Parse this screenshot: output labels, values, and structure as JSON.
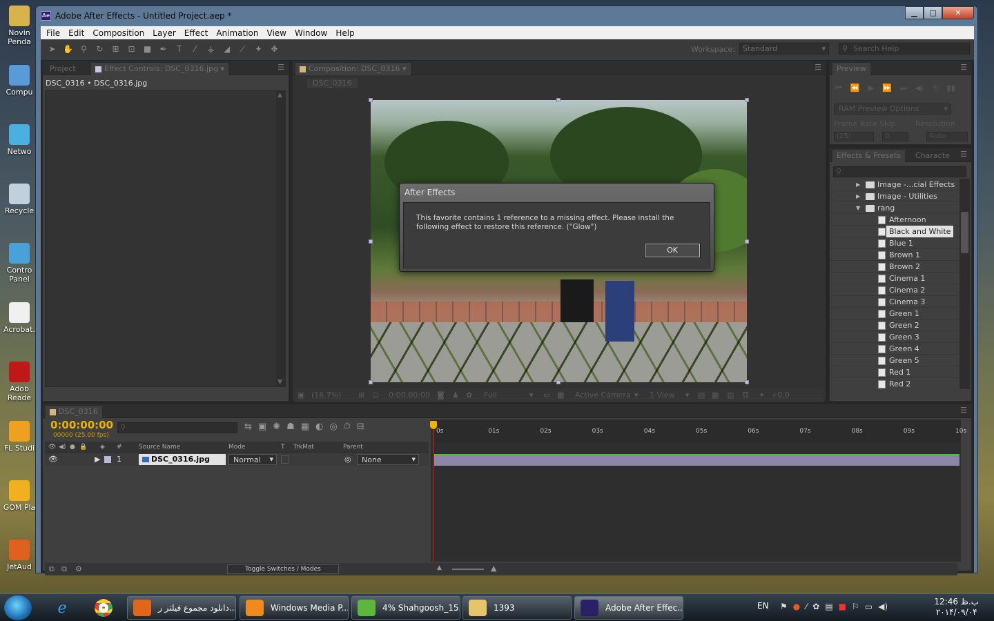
{
  "desktop_icons": [
    {
      "label": "Novin\nPenda",
      "name": "desktop-icon-novin-pendar",
      "color": "#d8b24a"
    },
    {
      "label": "Compu",
      "name": "desktop-icon-computer",
      "color": "#5a9ad8"
    },
    {
      "label": "Netwo",
      "name": "desktop-icon-network",
      "color": "#4ab0e0"
    },
    {
      "label": "Recycle",
      "name": "desktop-icon-recycle-bin",
      "color": "#c0d0dc"
    },
    {
      "label": "Contro\nPanel",
      "name": "desktop-icon-control-panel",
      "color": "#4aa0d8"
    },
    {
      "label": "Acrobat.",
      "name": "desktop-icon-acrobat",
      "color": "#f0f0f0"
    },
    {
      "label": "Adob\nReade",
      "name": "desktop-icon-adobe-reader",
      "color": "#c01818"
    },
    {
      "label": "FL Studi",
      "name": "desktop-icon-fl-studio",
      "color": "#f0a020"
    },
    {
      "label": "GOM Pla",
      "name": "desktop-icon-gom-player",
      "color": "#f0b020"
    },
    {
      "label": "JetAud",
      "name": "desktop-icon-jetaudio",
      "color": "#e06020"
    }
  ],
  "window": {
    "app_badge": "Ae",
    "title": "Adobe After Effects - Untitled Project.aep *",
    "minimize": "▁",
    "maximize": "□",
    "close": "✕"
  },
  "menu": [
    "File",
    "Edit",
    "Composition",
    "Layer",
    "Effect",
    "Animation",
    "View",
    "Window",
    "Help"
  ],
  "toolbar": {
    "workspace_label": "Workspace:",
    "workspace_value": "Standard",
    "search_placeholder": "Search Help"
  },
  "project_panel": {
    "tab_project": "Project",
    "tab_effect_controls": "Effect Controls: DSC_0316.jpg",
    "header": "DSC_0316 • DSC_0316.jpg"
  },
  "composition_panel": {
    "tab": "Composition: DSC_0316",
    "subtab": "DSC_0316",
    "zoom": "(16.7%)",
    "timecode": "0:00:00:00",
    "resolution": "Full",
    "camera": "Active Camera",
    "views": "1 View",
    "exposure": "+0.0"
  },
  "dialog": {
    "title": "After Effects",
    "message": "This favorite contains 1 reference to a missing effect. Please install the following effect to restore this reference. (\"Glow\")",
    "ok_label": "OK"
  },
  "preview_panel": {
    "tab": "Preview",
    "ram_preview": "RAM Preview Options",
    "frame_rate_label": "Frame Rate",
    "skip_label": "Skip",
    "resolution_label": "Resolution",
    "frame_rate_value": "(25)",
    "skip_value": "0",
    "resolution_value": "Auto"
  },
  "effects_panel": {
    "tab": "Effects & Presets",
    "tab_character": "Characte",
    "search_placeholder": "",
    "items": [
      {
        "label": "Image -...cial Effects",
        "kind": "folder",
        "expanded": false,
        "indent": 1
      },
      {
        "label": "Image - Utilities",
        "kind": "folder",
        "expanded": false,
        "indent": 1
      },
      {
        "label": "rang",
        "kind": "folder",
        "expanded": true,
        "indent": 1
      },
      {
        "label": "Afternoon",
        "kind": "preset",
        "indent": 2
      },
      {
        "label": "Black and White",
        "kind": "preset",
        "indent": 2,
        "selected": true
      },
      {
        "label": "Blue 1",
        "kind": "preset",
        "indent": 2
      },
      {
        "label": "Brown 1",
        "kind": "preset",
        "indent": 2
      },
      {
        "label": "Brown 2",
        "kind": "preset",
        "indent": 2
      },
      {
        "label": "Cinema 1",
        "kind": "preset",
        "indent": 2
      },
      {
        "label": "Cinema 2",
        "kind": "preset",
        "indent": 2
      },
      {
        "label": "Cinema 3",
        "kind": "preset",
        "indent": 2
      },
      {
        "label": "Green 1",
        "kind": "preset",
        "indent": 2
      },
      {
        "label": "Green 2",
        "kind": "preset",
        "indent": 2
      },
      {
        "label": "Green 3",
        "kind": "preset",
        "indent": 2
      },
      {
        "label": "Green 4",
        "kind": "preset",
        "indent": 2
      },
      {
        "label": "Green 5",
        "kind": "preset",
        "indent": 2
      },
      {
        "label": "Red 1",
        "kind": "preset",
        "indent": 2
      },
      {
        "label": "Red 2",
        "kind": "preset",
        "indent": 2
      }
    ]
  },
  "timeline": {
    "tab": "DSC_0316",
    "timecode": "0:00:00:00",
    "fps": "00000 (25.00 fps)",
    "columns": {
      "num": "#",
      "source": "Source Name",
      "mode": "Mode",
      "t": "T",
      "trkmat": "TrkMat",
      "parent": "Parent"
    },
    "layer": {
      "index": "1",
      "source": "DSC_0316.jpg",
      "mode": "Normal",
      "parent": "None"
    },
    "ruler": [
      "0s",
      "01s",
      "02s",
      "03s",
      "04s",
      "05s",
      "06s",
      "07s",
      "08s",
      "09s",
      "10s"
    ],
    "toggle_label": "Toggle Switches / Modes"
  },
  "taskbar": {
    "buttons": [
      {
        "label": "دانلود مجموع فیلتر ر...",
        "name": "taskbar-firefox",
        "color": "#e0661c"
      },
      {
        "label": "Windows Media P...",
        "name": "taskbar-wmp",
        "color": "#f08a1c"
      },
      {
        "label": "4% Shahgoosh_15...",
        "name": "taskbar-download",
        "color": "#5cb83c"
      },
      {
        "label": "1393",
        "name": "taskbar-folder",
        "color": "#e6c56a"
      },
      {
        "label": "Adobe After Effec...",
        "name": "taskbar-after-effects",
        "color": "#2a2066",
        "active": true
      }
    ],
    "lang": "EN",
    "time": "12:46 ب.ظ",
    "date": "۲۰۱۴/۰۹/۰۴"
  }
}
